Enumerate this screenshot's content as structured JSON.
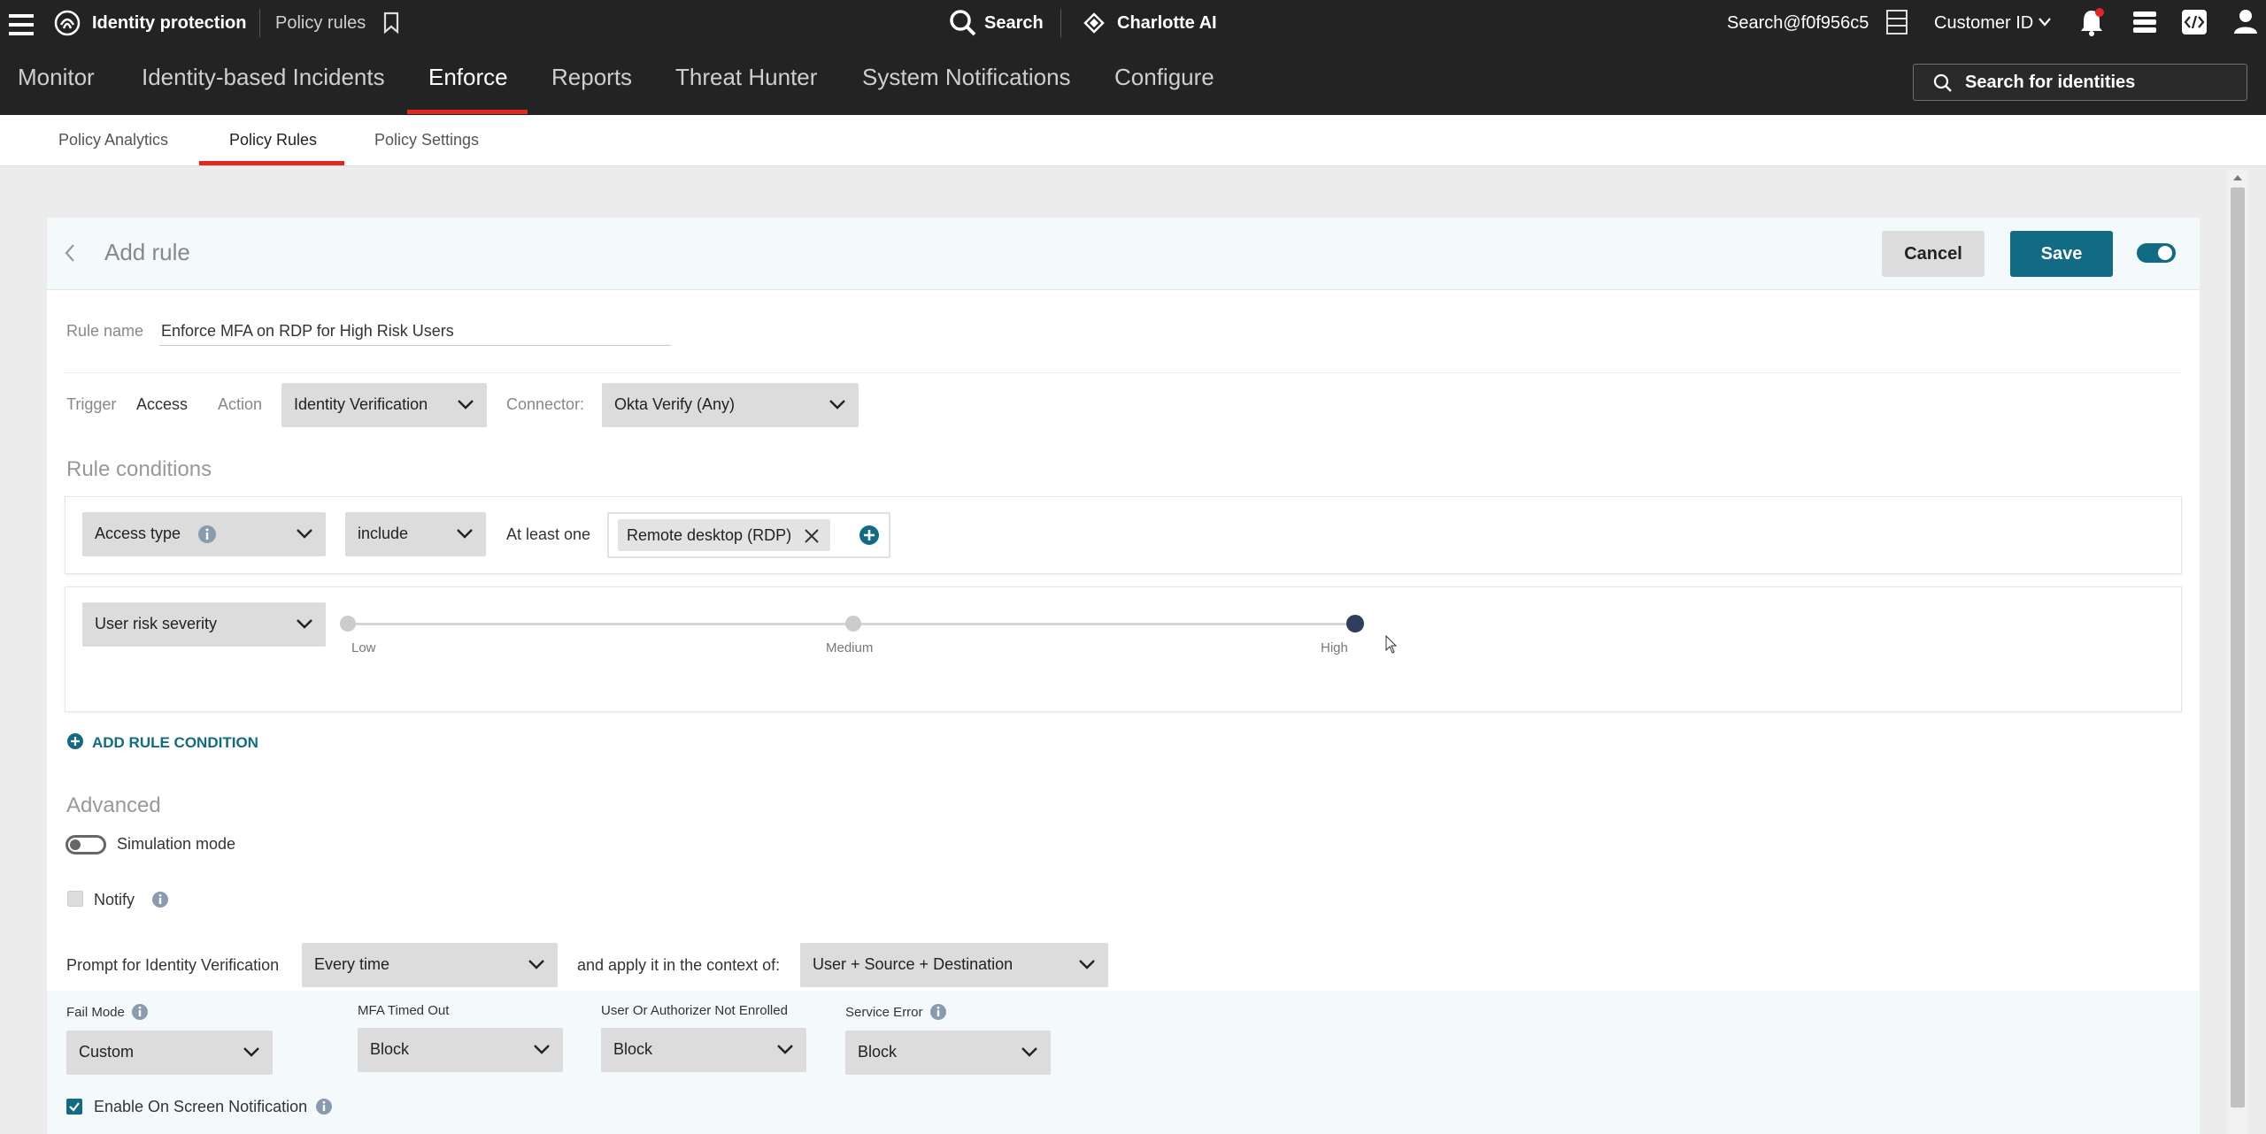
{
  "topbar": {
    "app_title": "Identity protection",
    "page_title": "Policy rules",
    "search_label": "Search",
    "ai_label": "Charlotte AI",
    "user": "Search@f0f956c5",
    "customer_id": "Customer ID"
  },
  "nav": {
    "items": [
      "Monitor",
      "Identity-based Incidents",
      "Enforce",
      "Reports",
      "Threat Hunter",
      "System Notifications",
      "Configure"
    ],
    "active": "Enforce",
    "identity_search_placeholder": "Search for identities"
  },
  "subtabs": {
    "items": [
      "Policy Analytics",
      "Policy Rules",
      "Policy Settings"
    ],
    "active": "Policy Rules"
  },
  "rule": {
    "header_title": "Add rule",
    "cancel_label": "Cancel",
    "save_label": "Save",
    "enabled": true,
    "name_label": "Rule name",
    "name_value": "Enforce MFA on RDP for High Risk Users",
    "trigger_label": "Trigger",
    "trigger_value": "Access",
    "action_label": "Action",
    "action_value": "Identity Verification",
    "connector_label": "Connector:",
    "connector_value": "Okta Verify (Any)"
  },
  "conditions": {
    "title": "Rule conditions",
    "access": {
      "field": "Access type",
      "operator": "include",
      "quantifier": "At least one",
      "tag": "Remote desktop (RDP)"
    },
    "risk": {
      "field": "User risk severity",
      "levels": [
        "Low",
        "Medium",
        "High"
      ],
      "selected": "High"
    },
    "add_label": "ADD RULE CONDITION"
  },
  "advanced": {
    "title": "Advanced",
    "simulation_label": "Simulation mode",
    "simulation_on": false,
    "notify_label": "Notify",
    "notify_checked": false,
    "prompt_label": "Prompt for Identity Verification",
    "prompt_value": "Every time",
    "context_label": "and apply it in the context of:",
    "context_value": "User + Source + Destination",
    "fail_mode_label": "Fail Mode",
    "fail_mode_value": "Custom",
    "mfa_timeout_label": "MFA Timed Out",
    "mfa_timeout_value": "Block",
    "not_enrolled_label": "User Or Authorizer Not Enrolled",
    "not_enrolled_value": "Block",
    "service_error_label": "Service Error",
    "service_error_value": "Block",
    "on_screen_label": "Enable On Screen Notification",
    "on_screen_checked": true
  },
  "colors": {
    "accent_red": "#e0281f",
    "primary_teal": "#116b84",
    "topbar_bg": "#232323"
  }
}
